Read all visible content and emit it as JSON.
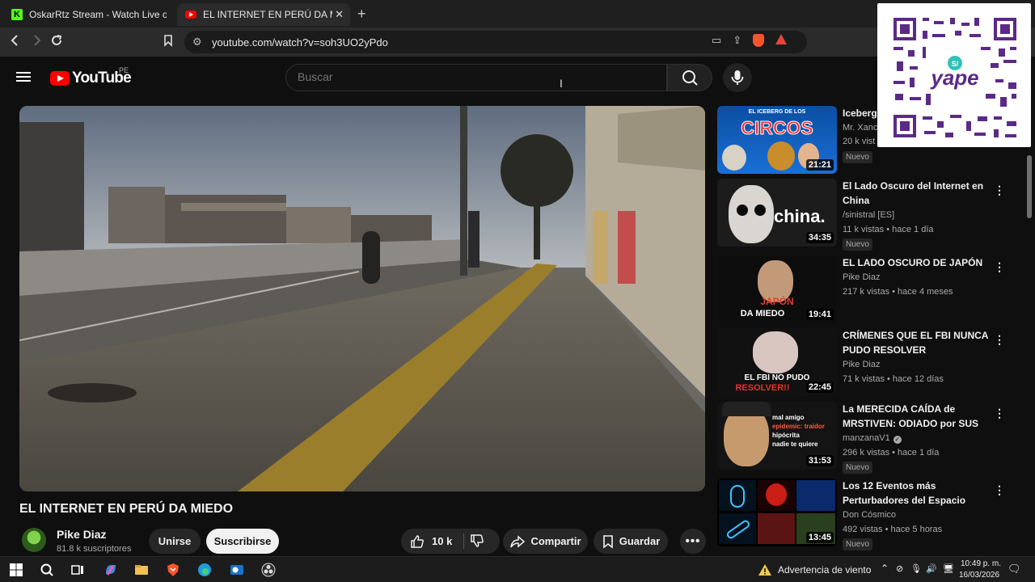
{
  "browser": {
    "tabs": [
      {
        "label": "OskarRtz Stream - Watch Live on Kick"
      },
      {
        "label": "EL INTERNET EN PERÚ DA MIEDO"
      }
    ],
    "url": "youtube.com/watch?v=soh3UO2yPdo",
    "brave_badge": "99+"
  },
  "header": {
    "logo_text": "YouTube",
    "country": "PE",
    "search_placeholder": "Buscar"
  },
  "video": {
    "title": "EL INTERNET EN PERÚ DA MIEDO",
    "channel": "Pike Diaz",
    "subscribers": "81.8 k suscriptores",
    "join_label": "Unirse",
    "subscribe_label": "Suscribirse",
    "likes": "10 k",
    "share_label": "Compartir",
    "save_label": "Guardar"
  },
  "recommendations": [
    {
      "title": "Iceberg",
      "channel": "Mr. Xanc",
      "meta": "20 k vist",
      "badge": "Nuevo",
      "duration": "21:21",
      "thumb_text": "CIRCOS",
      "thumb_top": "EL ICEBERG DE LOS"
    },
    {
      "title": "El Lado Oscuro del Internet en China",
      "channel": "/sinistral [ES]",
      "meta": "11 k vistas • hace 1 día",
      "badge": "Nuevo",
      "duration": "34:35",
      "thumb_text": "china."
    },
    {
      "title": "EL LADO OSCURO DE JAPÓN",
      "channel": "Pike Diaz",
      "meta": "217 k vistas • hace 4 meses",
      "badge": "",
      "duration": "19:41",
      "thumb_text": "JAPÓN",
      "thumb_sub": "DA MIEDO"
    },
    {
      "title": "CRÍMENES QUE EL FBI NUNCA PUDO RESOLVER",
      "channel": "Pike Diaz",
      "meta": "71 k vistas • hace 12 días",
      "badge": "",
      "duration": "22:45",
      "thumb_text": "EL FBI NO PUDO",
      "thumb_sub": "RESOLVER!!"
    },
    {
      "title": "La MERECIDA CAÍDA de MRSTIVEN: ODIADO por SUS ...",
      "channel": "manzanaV1",
      "meta": "296 k vistas • hace 1 día",
      "badge": "Nuevo",
      "duration": "31:53",
      "thumb_lines": [
        "mal amigo",
        "epidemic: traidor",
        "hipócrita",
        "nadie te quiere"
      ]
    },
    {
      "title": "Los 12 Eventos más Perturbadores del Espacio",
      "channel": "Don Cósmico",
      "meta": "492 vistas • hace 5 horas",
      "badge": "Nuevo",
      "duration": "13:45"
    }
  ],
  "taskbar": {
    "weather": "Advertencia de viento",
    "time": "10:49 p. m.",
    "date": "16/03/2026"
  },
  "colors": {
    "youtube_red": "#ff0000",
    "kick_green": "#53fc18",
    "background": "#0f0f0f"
  }
}
